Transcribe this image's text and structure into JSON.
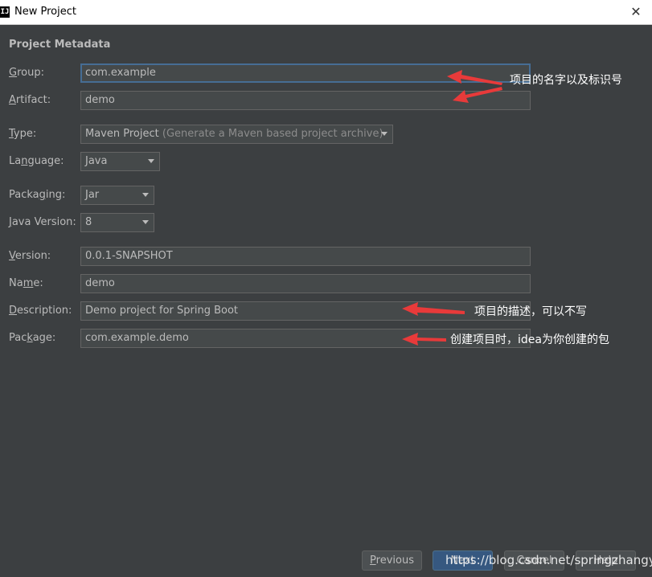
{
  "window": {
    "title": "New Project",
    "close_glyph": "✕",
    "app_icon_text": "IJ"
  },
  "section_title": "Project Metadata",
  "fields": {
    "group": {
      "label_mn": "G",
      "label_rest": "roup:",
      "value": "com.example"
    },
    "artifact": {
      "label_mn": "A",
      "label_rest": "rtifact:",
      "value": "demo"
    },
    "type": {
      "label_mn": "T",
      "label_rest": "ype:",
      "value": "Maven Project",
      "hint": "(Generate a Maven based project archive)"
    },
    "language": {
      "label_pre": "La",
      "label_mn": "n",
      "label_rest": "guage:",
      "value": "Java"
    },
    "packaging": {
      "label_pre": "Packa",
      "label_mn": "g",
      "label_rest": "ing:",
      "value": "Jar"
    },
    "java_version": {
      "label_mn": "J",
      "label_rest": "ava Version:",
      "value": "8"
    },
    "version": {
      "label_mn": "V",
      "label_rest": "ersion:",
      "value": "0.0.1-SNAPSHOT"
    },
    "name": {
      "label_pre": "Na",
      "label_mn": "m",
      "label_rest": "e:",
      "value": "demo"
    },
    "description": {
      "label_mn": "D",
      "label_rest": "escription:",
      "value": "Demo project for Spring Boot"
    },
    "package": {
      "label_pre": "Pac",
      "label_mn": "k",
      "label_rest": "age:",
      "value": "com.example.demo"
    }
  },
  "annotations": {
    "group_artifact": "项目的名字以及标识号",
    "description": "项目的描述，可以不写",
    "package": "创建项目时，idea为你创建的包"
  },
  "buttons": {
    "previous": {
      "label_mn": "P",
      "label_rest": "revious"
    },
    "next": {
      "label": "Next"
    },
    "cancel": {
      "label": "Cancel"
    },
    "help": {
      "label": "Help"
    }
  },
  "watermark": "https://blog.csdn.net/springzhangyf",
  "colors": {
    "background": "#3c3f41",
    "field_bg": "#45494a",
    "focus_border": "#466d94",
    "arrow": "#e83a3a",
    "primary_button": "#365880"
  }
}
